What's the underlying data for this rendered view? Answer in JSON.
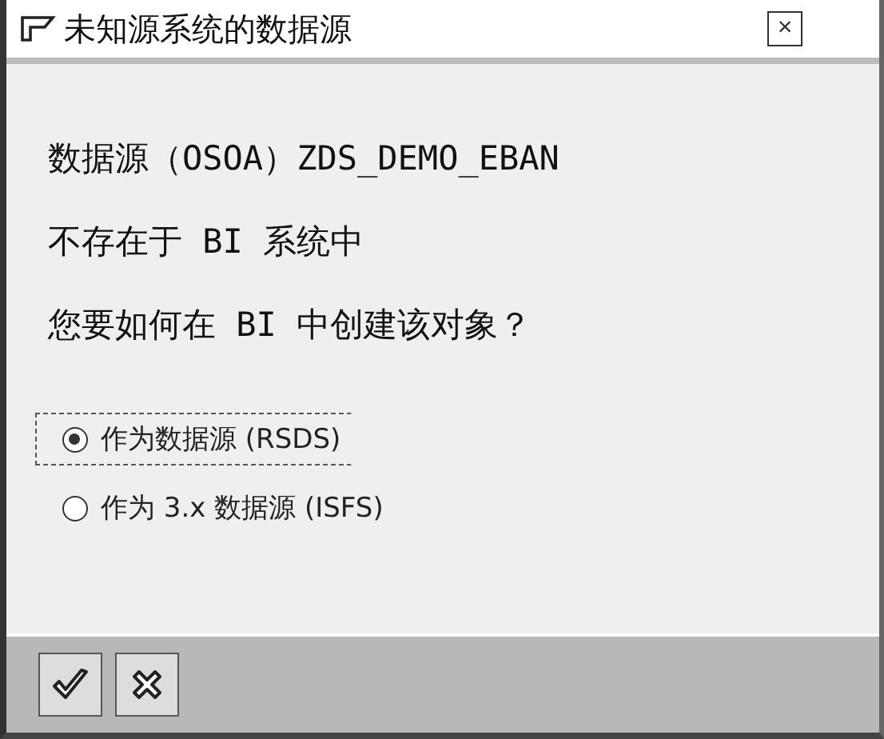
{
  "window": {
    "title": "未知源系统的数据源",
    "close": "×"
  },
  "message": [
    "数据源（OSOA）ZDS_DEMO_EBAN",
    "不存在于 BI 系统中",
    "您要如何在 BI 中创建该对象？"
  ],
  "options": [
    {
      "label": "作为数据源 (RSDS)",
      "selected": true
    },
    {
      "label": "作为 3.x 数据源 (ISFS)",
      "selected": false
    }
  ],
  "buttons": [
    {
      "kind": "confirm"
    },
    {
      "kind": "cancel"
    }
  ]
}
